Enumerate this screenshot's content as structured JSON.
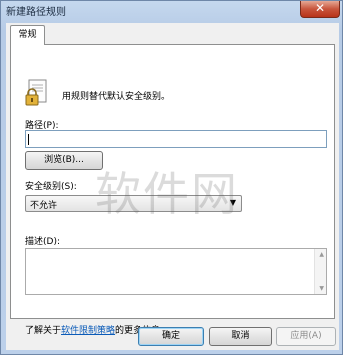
{
  "window": {
    "title": "新建路径规则",
    "close_glyph": "✕"
  },
  "tabs": [
    {
      "label": "常规",
      "active": true
    }
  ],
  "description_text": "用规则替代默认安全级别。",
  "path": {
    "label": "路径(P):",
    "value": "",
    "browse_label": "浏览(B)..."
  },
  "security_level": {
    "label": "安全级别(S):",
    "selected": "不允许",
    "arrow": "▼"
  },
  "description": {
    "label": "描述(D):",
    "value": ""
  },
  "info": {
    "prefix": "了解关于",
    "link_text": "软件限制策略",
    "suffix": "的更多信息"
  },
  "buttons": {
    "ok": "确定",
    "cancel": "取消",
    "apply": "应用(A)"
  },
  "watermark": "软件网",
  "icons": {
    "lock": "lock-document-icon"
  },
  "colors": {
    "link": "#0b5bb8",
    "titlebar": "#c5d8ee",
    "close": "#c8553c"
  }
}
